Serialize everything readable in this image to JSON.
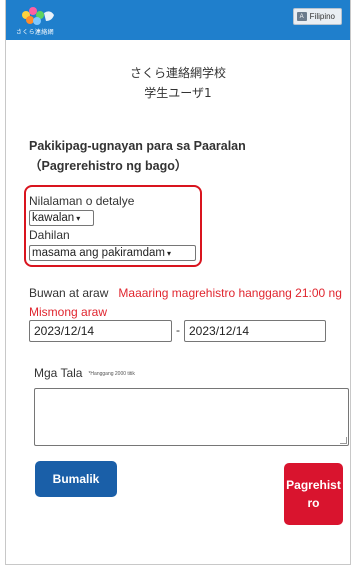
{
  "header": {
    "logo_text": "さくら連絡網",
    "language_button": "Filipino",
    "language_icon": "translate-icon"
  },
  "school": {
    "name": "さくら連絡網学校",
    "user": "学生ユーザ1"
  },
  "form": {
    "title": "Pakikipag-ugnayan para sa Paaralan（Pagrerehistro ng bago）",
    "content_label": "Nilalaman o detalye",
    "content_value": "kawalan",
    "reason_label": "Dahilan",
    "reason_value": "masama ang pakiramdam",
    "date_label": "Buwan at araw",
    "date_note": "Maaaring magrehistro hanggang 21:00 ng Mismong araw",
    "date_from": "2023/12/14",
    "date_to": "2023/12/14",
    "date_separator": "-",
    "notes_label": "Mga Tala",
    "notes_limit": "*Hanggang 2000 titik",
    "notes_value": ""
  },
  "buttons": {
    "back": "Bumalik",
    "register": "Pagrehistro"
  },
  "colors": {
    "header": "#1f7fcc",
    "back_button": "#1a5fa8",
    "register_button": "#d9142e",
    "highlight": "#d9141e",
    "note_red": "#e0262f"
  }
}
